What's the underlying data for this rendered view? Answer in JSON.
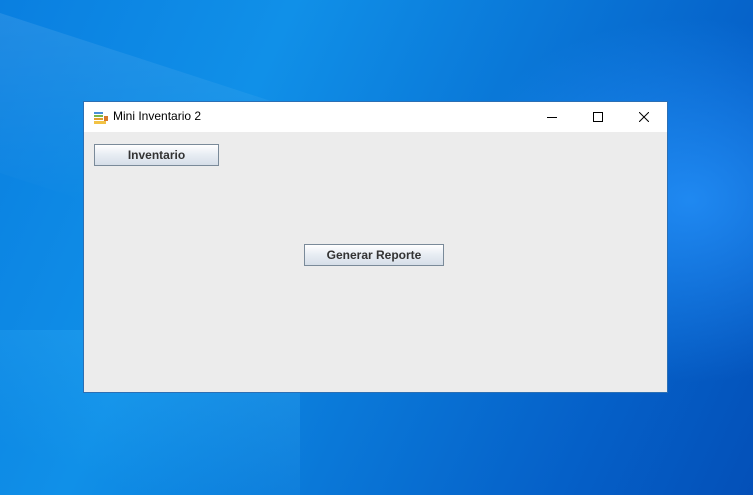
{
  "window": {
    "title": "Mini Inventario 2",
    "app_icon": "inventory-app-icon",
    "controls": {
      "minimize_icon": "minimize-icon",
      "maximize_icon": "maximize-icon",
      "close_icon": "close-icon"
    }
  },
  "content": {
    "inventario_label": "Inventario",
    "generar_reporte_label": "Generar Reporte"
  },
  "colors": {
    "desktop_blue": "#0a78d8",
    "window_bg": "#ececec",
    "titlebar_bg": "#ffffff"
  }
}
